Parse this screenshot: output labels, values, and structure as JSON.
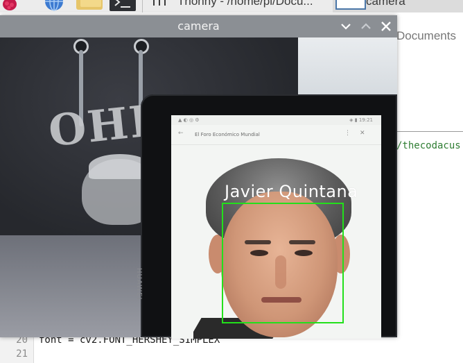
{
  "taskbar": {
    "thonny_task_label": "Thonny  -  /home/pi/Docu...",
    "camera_task_label": "camera"
  },
  "background_editor": {
    "docs_label": "Documents",
    "snippet_text": "/thecodacus",
    "lines": [
      {
        "number": "20",
        "code": "font = cv2.FONT_HERSHEY_SIMPLEX"
      },
      {
        "number": "21",
        "code": ""
      }
    ]
  },
  "camera_window": {
    "title": "camera",
    "tablet_brand": "HUAWEI",
    "tablet_screen": {
      "status_left": "▲ ◐ ◎ ⚙",
      "status_right": "◈ ▮ 19:21",
      "page_title": "El Foro Económico Mundial",
      "back_symbol": "←",
      "menu_symbol": "⋮",
      "close_symbol": "✕"
    },
    "detection": {
      "label": "Javier Quintana",
      "box_color": "#22e01b",
      "label_color": "#ffffff"
    }
  }
}
